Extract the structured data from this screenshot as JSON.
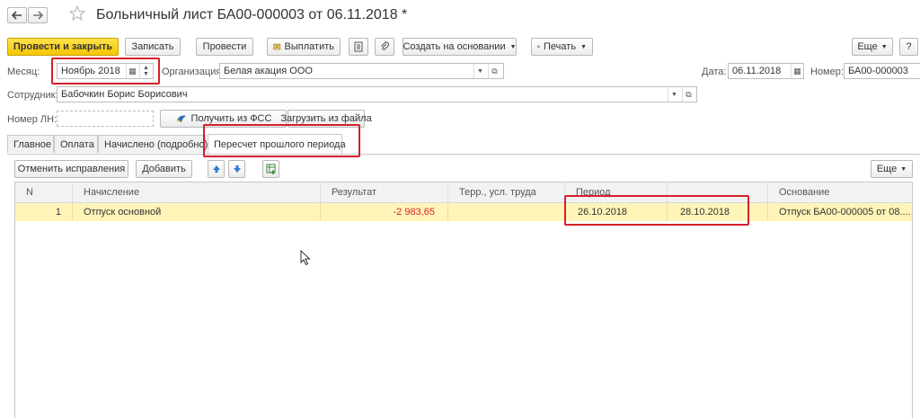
{
  "window": {
    "title": "Больничный лист БА00-000003 от 06.11.2018 *"
  },
  "toolbar": {
    "post_close": "Провести и закрыть",
    "save": "Записать",
    "post": "Провести",
    "pay": "Выплатить",
    "create_based": "Создать на основании",
    "print": "Печать",
    "more": "Еще",
    "help": "?"
  },
  "form": {
    "month_label": "Месяц:",
    "month_value": "Ноябрь 2018",
    "org_label": "Организация:",
    "org_value": "Белая акация ООО",
    "date_label": "Дата:",
    "date_value": "06.11.2018",
    "number_label": "Номер:",
    "number_value": "БА00-000003",
    "employee_label": "Сотрудник:",
    "employee_value": "Бабочкин Борис Борисович",
    "ln_label": "Номер ЛН:",
    "ln_value": "",
    "get_fss": "Получить из ФСС",
    "load_file": "Загрузить из файла"
  },
  "tabs": [
    {
      "label": "Главное"
    },
    {
      "label": "Оплата"
    },
    {
      "label": "Начислено (подробно)"
    },
    {
      "label": "Пересчет прошлого периода"
    }
  ],
  "subtoolbar": {
    "cancel_corrections": "Отменить исправления",
    "add": "Добавить",
    "more": "Еще"
  },
  "table": {
    "columns": [
      "N",
      "Начисление",
      "Результат",
      "Терр., усл. труда",
      "Период",
      "",
      "Основание"
    ],
    "rows": [
      {
        "n": "1",
        "accrual": "Отпуск основной",
        "result": "-2 983,65",
        "terr": "",
        "period_start": "26.10.2018",
        "period_end": "28.10.2018",
        "basis": "Отпуск БА00-000005 от 08...."
      }
    ]
  },
  "colors": {
    "primary_button": "#f5c600",
    "row_highlight": "#fff5b8",
    "negative_value": "#d6202a",
    "annotation": "#d6202a"
  }
}
